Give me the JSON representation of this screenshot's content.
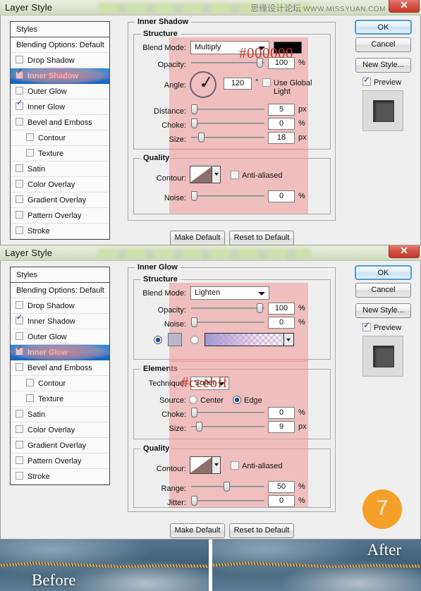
{
  "watermark": {
    "cn": "思缘设计论坛",
    "en": "WWW.MISSYUAN.COM"
  },
  "dialog1": {
    "title": "Layer Style",
    "close_label": "✕",
    "styles_header": "Styles",
    "styles": [
      {
        "label": "Blending Options: Default",
        "type": "plain"
      },
      {
        "label": "Drop Shadow",
        "checked": false
      },
      {
        "label": "Inner Shadow",
        "checked": true,
        "selected": true
      },
      {
        "label": "Outer Glow",
        "checked": false
      },
      {
        "label": "Inner Glow",
        "checked": true
      },
      {
        "label": "Bevel and Emboss",
        "checked": false
      },
      {
        "label": "Contour",
        "checked": false,
        "sub": true
      },
      {
        "label": "Texture",
        "checked": false,
        "sub": true
      },
      {
        "label": "Satin",
        "checked": false
      },
      {
        "label": "Color Overlay",
        "checked": false
      },
      {
        "label": "Gradient Overlay",
        "checked": false
      },
      {
        "label": "Pattern Overlay",
        "checked": false
      },
      {
        "label": "Stroke",
        "checked": false
      }
    ],
    "group_title": "Inner Shadow",
    "structure_legend": "Structure",
    "quality_legend": "Quality",
    "hex_note": "#000000",
    "blend_mode_label": "Blend Mode:",
    "blend_mode_value": "Multiply",
    "shadow_color": "#000000",
    "opacity_label": "Opacity:",
    "opacity_value": "100",
    "opacity_unit": "%",
    "angle_label": "Angle:",
    "angle_value": "120",
    "angle_unit": "°",
    "global_light_label": "Use Global Light",
    "global_light_checked": false,
    "distance_label": "Distance:",
    "distance_value": "5",
    "distance_unit": "px",
    "choke_label": "Choke:",
    "choke_value": "0",
    "choke_unit": "%",
    "size_label": "Size:",
    "size_value": "18",
    "size_unit": "px",
    "contour_label": "Contour:",
    "antialiased_label": "Anti-aliased",
    "antialiased_checked": false,
    "noise_label": "Noise:",
    "noise_value": "0",
    "noise_unit": "%",
    "make_default": "Make Default",
    "reset_default": "Reset to Default",
    "ok": "OK",
    "cancel": "Cancel",
    "new_style": "New Style...",
    "preview_label": "Preview",
    "preview_checked": true
  },
  "dialog2": {
    "title": "Layer Style",
    "close_label": "✕",
    "styles_header": "Styles",
    "styles": [
      {
        "label": "Blending Options: Default",
        "type": "plain"
      },
      {
        "label": "Drop Shadow",
        "checked": false
      },
      {
        "label": "Inner Shadow",
        "checked": true
      },
      {
        "label": "Outer Glow",
        "checked": false
      },
      {
        "label": "Inner Glow",
        "checked": true,
        "selected": true
      },
      {
        "label": "Bevel and Emboss",
        "checked": false
      },
      {
        "label": "Contour",
        "checked": false,
        "sub": true
      },
      {
        "label": "Texture",
        "checked": false,
        "sub": true
      },
      {
        "label": "Satin",
        "checked": false
      },
      {
        "label": "Color Overlay",
        "checked": false
      },
      {
        "label": "Gradient Overlay",
        "checked": false
      },
      {
        "label": "Pattern Overlay",
        "checked": false
      },
      {
        "label": "Stroke",
        "checked": false
      }
    ],
    "group_title": "Inner Glow",
    "structure_legend": "Structure",
    "elements_legend": "Elements",
    "quality_legend": "Quality",
    "hex_note": "#ccebff",
    "blend_mode_label": "Blend Mode:",
    "blend_mode_value": "Lighten",
    "opacity_label": "Opacity:",
    "opacity_value": "100",
    "opacity_unit": "%",
    "noise_label": "Noise:",
    "noise_value": "0",
    "noise_unit": "%",
    "fill_color_selected": true,
    "fill_gradient_selected": false,
    "technique_label": "Technique:",
    "technique_value": "Softer",
    "source_label": "Source:",
    "source_center_label": "Center",
    "source_edge_label": "Edge",
    "source_selected": "Edge",
    "choke_label": "Choke:",
    "choke_value": "0",
    "choke_unit": "%",
    "size_label": "Size:",
    "size_value": "9",
    "size_unit": "px",
    "contour_label": "Contour:",
    "antialiased_label": "Anti-aliased",
    "antialiased_checked": false,
    "range_label": "Range:",
    "range_value": "50",
    "range_unit": "%",
    "jitter_label": "Jitter:",
    "jitter_value": "0",
    "jitter_unit": "%",
    "make_default": "Make Default",
    "reset_default": "Reset to Default",
    "ok": "OK",
    "cancel": "Cancel",
    "new_style": "New Style...",
    "preview_label": "Preview",
    "preview_checked": true
  },
  "badge": {
    "number": "7",
    "color": "#f5a02a"
  },
  "photos": [
    {
      "caption": "Before",
      "position": "bottom-left"
    },
    {
      "caption": "After",
      "position": "top-right"
    }
  ]
}
